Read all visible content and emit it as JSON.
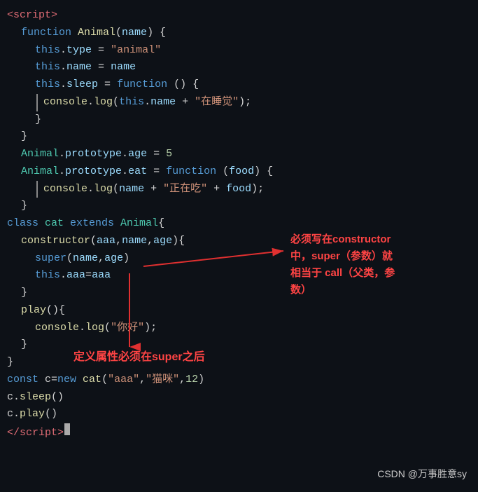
{
  "watermark": "CSDN @万事胜意sy",
  "annotation1": {
    "text": "必须写在constructor\n中，super（参数）就\n相当于 call（父类，参\n数）",
    "note2": "定义属性必须在super之后"
  }
}
